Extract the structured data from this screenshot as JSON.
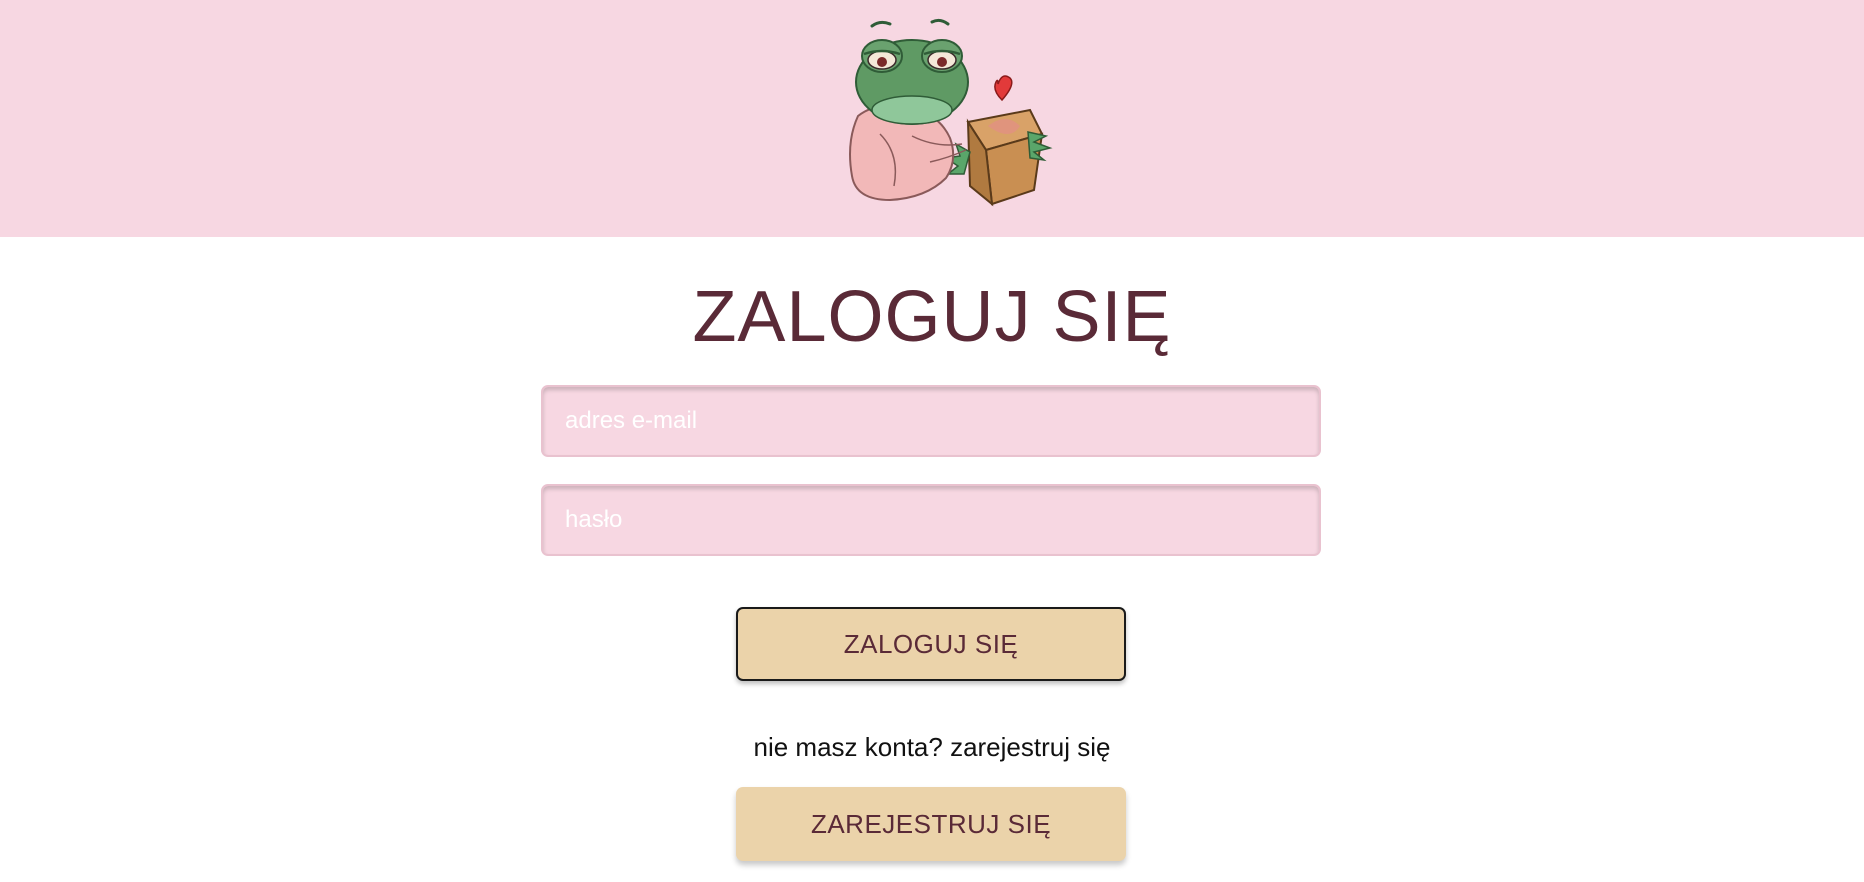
{
  "header": {
    "mascot": "frog-in-pink-hoodie-with-box-illustration",
    "background_color": "#f7d7e2"
  },
  "login": {
    "title": "ZALOGUJ SIĘ",
    "email_placeholder": "adres e-mail",
    "email_value": "",
    "password_placeholder": "hasło",
    "password_value": "",
    "submit_label": "ZALOGUJ SIĘ",
    "register_prompt": "nie masz konta? zarejestruj się",
    "register_label": "ZAREJESTRUJ SIĘ"
  },
  "colors": {
    "accent_text": "#5a2a37",
    "input_bg": "#f7d7e2",
    "button_bg": "#ebd3aa"
  }
}
